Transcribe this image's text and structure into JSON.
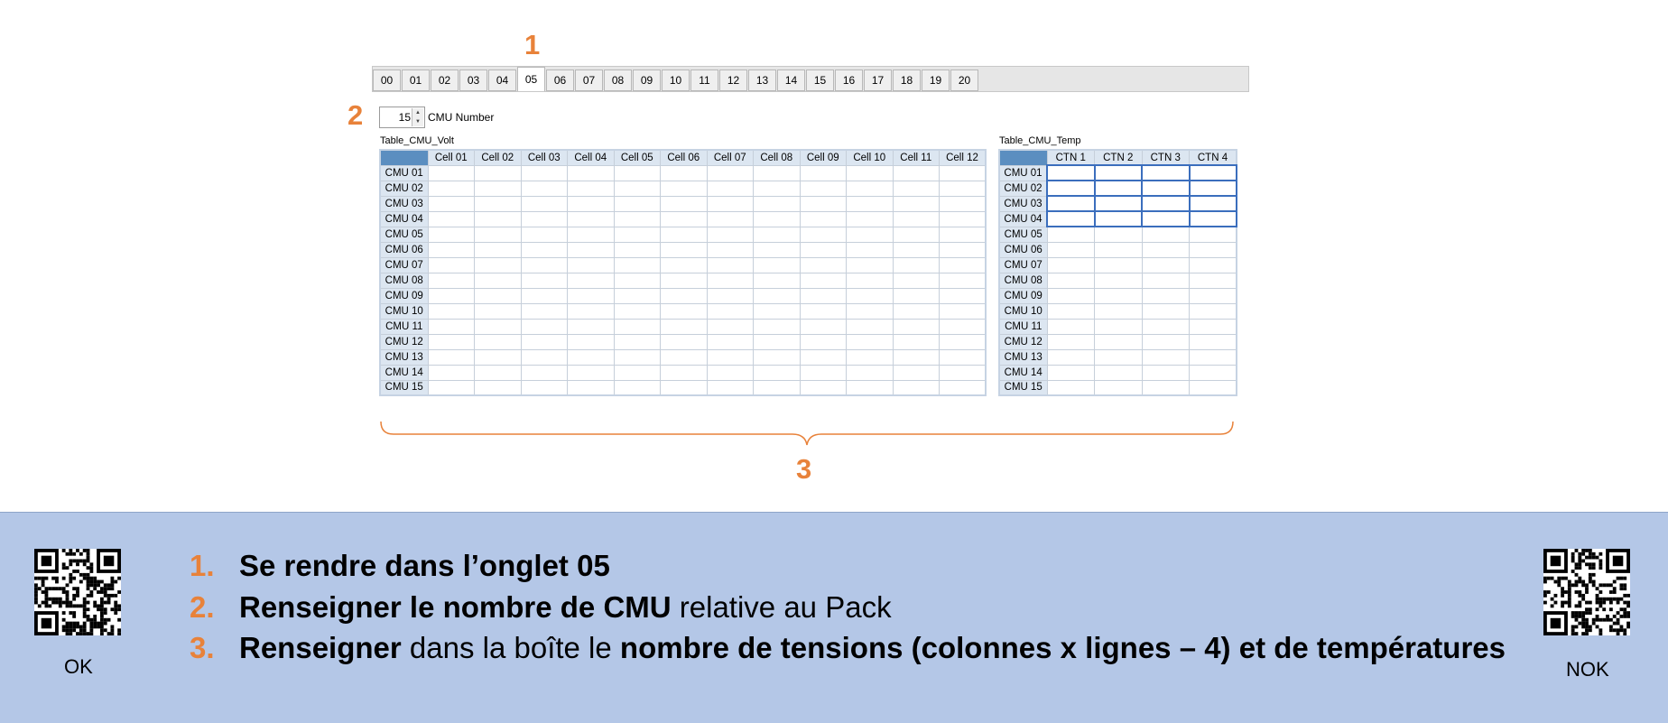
{
  "markers": {
    "tabs": "1",
    "cmu": "2",
    "tables": "3"
  },
  "tabs": [
    "00",
    "01",
    "02",
    "03",
    "04",
    "05",
    "06",
    "07",
    "08",
    "09",
    "10",
    "11",
    "12",
    "13",
    "14",
    "15",
    "16",
    "17",
    "18",
    "19",
    "20"
  ],
  "active_tab": "05",
  "cmu_number": {
    "value": "15",
    "label": "CMU Number"
  },
  "volt_table": {
    "title": "Table_CMU_Volt",
    "columns": [
      "Cell 01",
      "Cell 02",
      "Cell 03",
      "Cell 04",
      "Cell 05",
      "Cell 06",
      "Cell 07",
      "Cell 08",
      "Cell 09",
      "Cell 10",
      "Cell 11",
      "Cell 12"
    ],
    "rows": [
      "CMU 01",
      "CMU 02",
      "CMU 03",
      "CMU 04",
      "CMU 05",
      "CMU 06",
      "CMU 07",
      "CMU 08",
      "CMU 09",
      "CMU 10",
      "CMU 11",
      "CMU 12",
      "CMU 13",
      "CMU 14",
      "CMU 15"
    ]
  },
  "temp_table": {
    "title": "Table_CMU_Temp",
    "columns": [
      "CTN 1",
      "CTN 2",
      "CTN 3",
      "CTN 4"
    ],
    "rows": [
      "CMU 01",
      "CMU 02",
      "CMU 03",
      "CMU 04",
      "CMU 05",
      "CMU 06",
      "CMU 07",
      "CMU 08",
      "CMU 09",
      "CMU 10",
      "CMU 11",
      "CMU 12",
      "CMU 13",
      "CMU 14",
      "CMU 15"
    ],
    "highlighted_rows": 4
  },
  "instructions": [
    {
      "num": "1.",
      "parts": [
        {
          "text": "Se rendre dans l’onglet 05",
          "bold": true
        }
      ]
    },
    {
      "num": "2.",
      "parts": [
        {
          "text": "Renseigner le nombre de CMU",
          "bold": true
        },
        {
          "text": " relative au Pack",
          "bold": false
        }
      ]
    },
    {
      "num": "3.",
      "parts": [
        {
          "text": "Renseigner",
          "bold": true
        },
        {
          "text": " dans la boîte le ",
          "bold": false
        },
        {
          "text": "nombre de tensions (colonnes x lignes – 4) et de températures",
          "bold": true
        }
      ]
    }
  ],
  "qr_ok": {
    "label": "OK",
    "icon": "qr-code-icon"
  },
  "qr_nok": {
    "label": "NOK",
    "icon": "qr-code-icon"
  },
  "colors": {
    "accent": "#e8823a",
    "band": "#b4c7e7",
    "header": "#dce6f1",
    "corner": "#5b8ec0"
  }
}
